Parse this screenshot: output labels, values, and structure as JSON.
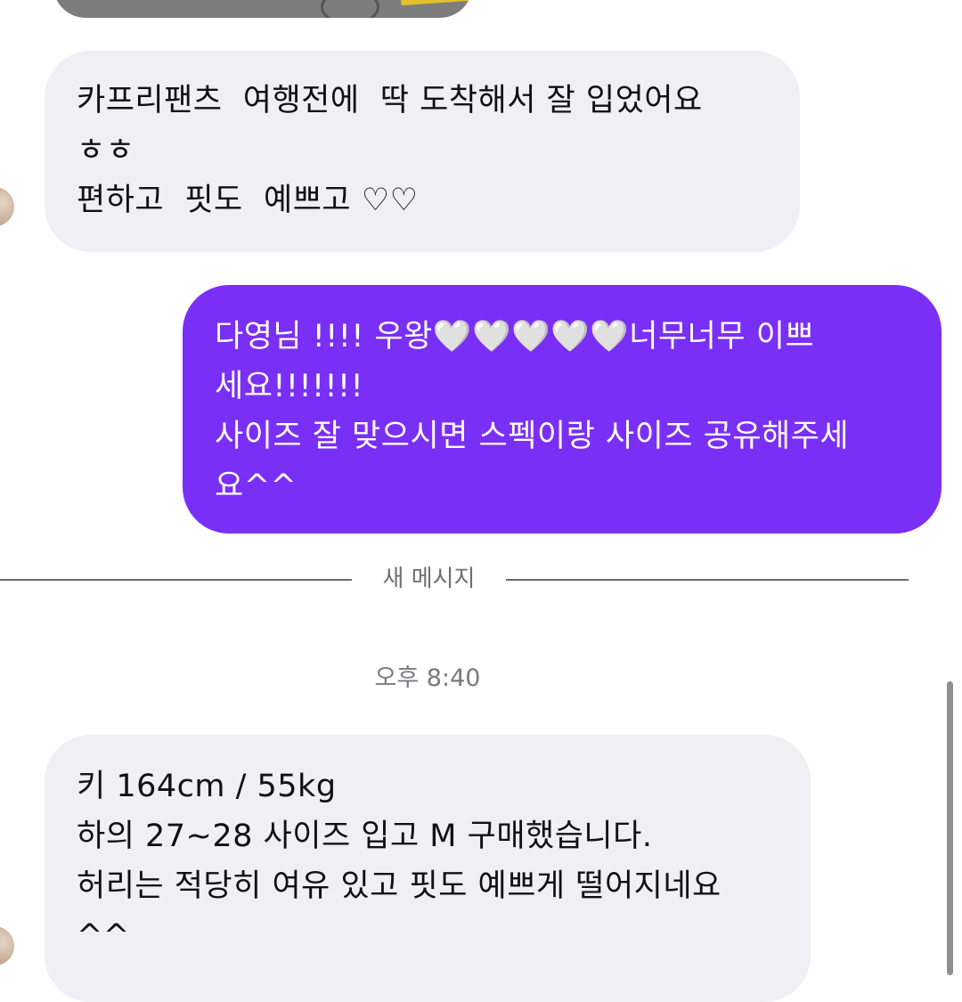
{
  "messages": [
    {
      "direction": "incoming",
      "lines": [
        "카프리팬츠  여행전에  딱 도착해서 잘 입었어요",
        "ㅎㅎ",
        "편하고  핏도  예쁘고 ♡♡"
      ]
    },
    {
      "direction": "outgoing",
      "lines": [
        "다영님 !!!! 우왕🤍🤍🤍🤍🤍너무너무 이쁘",
        "세요!!!!!!!",
        "사이즈 잘 맞으시면 스펙이랑 사이즈 공유해주세",
        "요^^"
      ]
    },
    {
      "direction": "incoming",
      "lines": [
        "키 164cm / 55kg",
        "하의 27~28 사이즈 입고 M 구매했습니다.",
        "허리는 적당히 여유 있고 핏도 예쁘게 떨어지네요",
        "^^"
      ]
    }
  ],
  "divider": {
    "label": "새 메시지"
  },
  "timestamp": "오후 8:40",
  "colors": {
    "outgoing_bubble": "#7a2ff6",
    "incoming_bubble": "#efeff4"
  }
}
